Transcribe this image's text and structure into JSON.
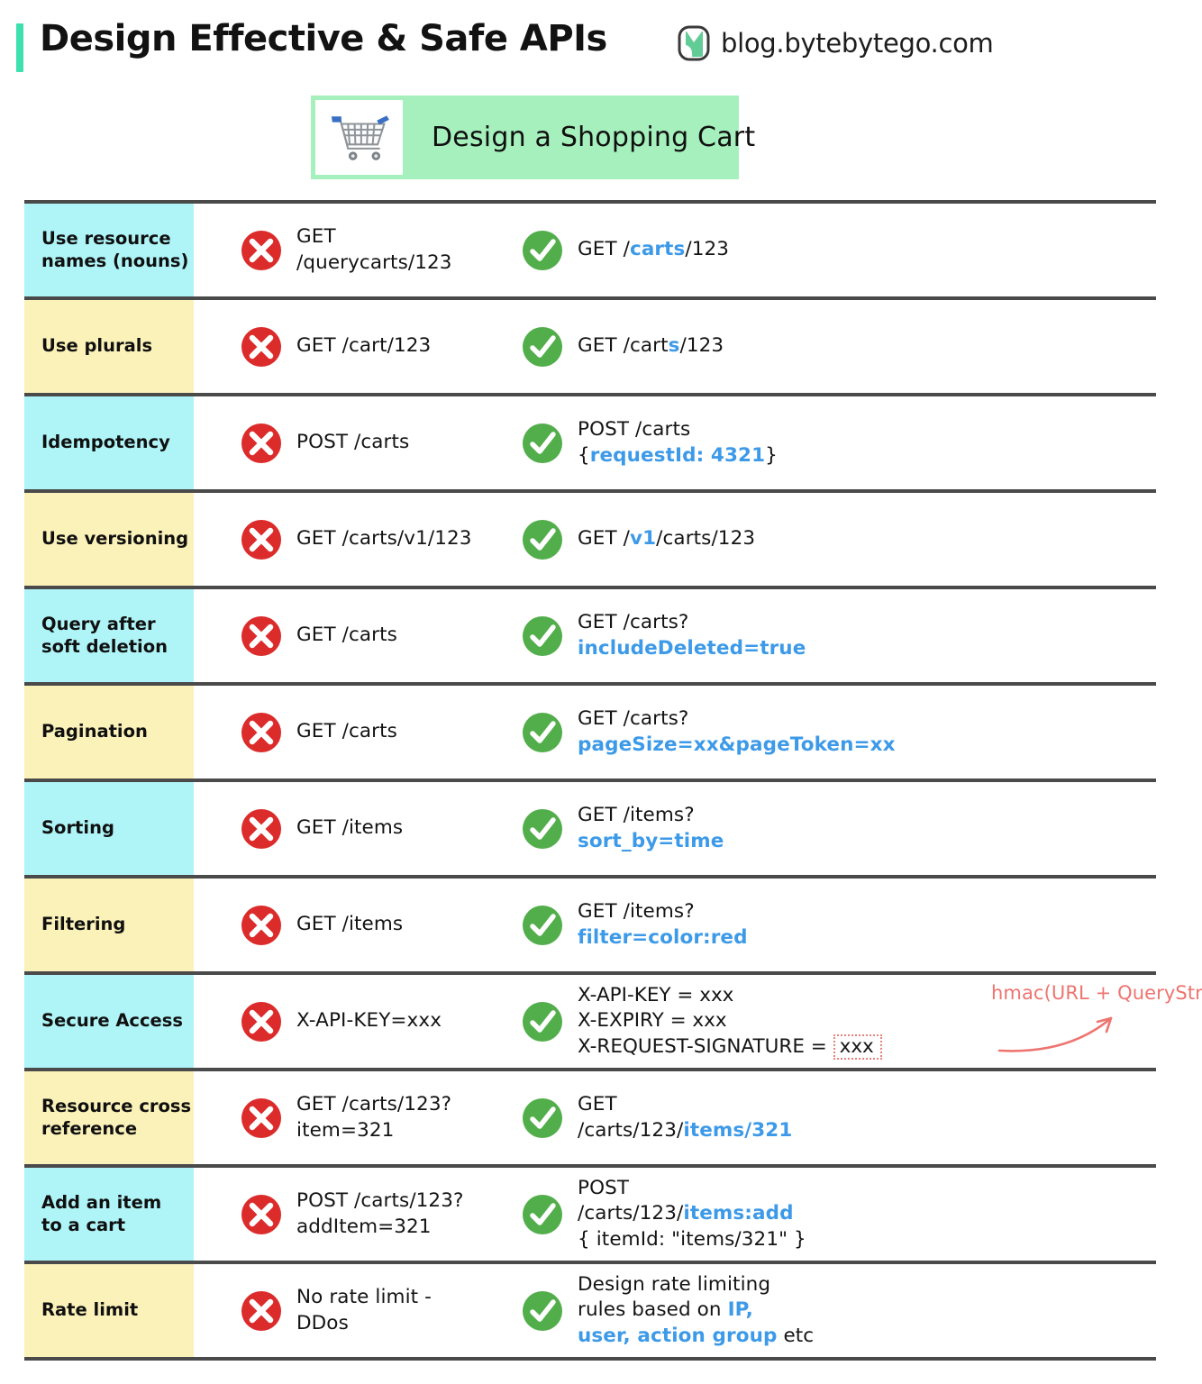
{
  "header": {
    "title": "Design Effective & Safe APIs",
    "brand": "blog.bytebytego.com",
    "logo_icon": "bytebytego-logo-icon",
    "accent_color": "#3ee0ae"
  },
  "banner": {
    "label": "Design a Shopping Cart",
    "icon": "shopping-cart-icon",
    "background_color": "#a5f0bc"
  },
  "legend": {
    "bad_icon": "red-x-circle-icon",
    "good_icon": "green-check-circle-icon",
    "highlight_color": "#3d9ae8",
    "annotation_color": "#ee7470",
    "label_cyan": "#aff5f8",
    "label_yellow": "#fbf2b9"
  },
  "rows": [
    {
      "label": "Use resource\nnames (nouns)",
      "label_color": "cyan",
      "bad": "GET /querycarts/123",
      "good_pre": "GET /",
      "good_hl": "carts",
      "good_post": "/123"
    },
    {
      "label": "Use plurals",
      "label_color": "yellow",
      "bad": "GET /cart/123",
      "good_pre": "GET /cart",
      "good_hl": "s",
      "good_post": "/123"
    },
    {
      "label": "Idempotency",
      "label_color": "cyan",
      "bad": "POST /carts",
      "good_pre": "POST /carts\n{",
      "good_hl": "requestId: 4321",
      "good_post": "}"
    },
    {
      "label": "Use versioning",
      "label_color": "yellow",
      "bad": "GET /carts/v1/123",
      "good_pre": "GET /",
      "good_hl": "v1",
      "good_post": "/carts/123"
    },
    {
      "label": "Query after\nsoft deletion",
      "label_color": "cyan",
      "bad": "GET /carts",
      "good_pre": "GET /carts?\n",
      "good_hl": "includeDeleted=true",
      "good_post": ""
    },
    {
      "label": "Pagination",
      "label_color": "yellow",
      "bad": "GET /carts",
      "good_pre": "GET /carts?\n",
      "good_hl": "pageSize=xx&pageToken=xx",
      "good_post": ""
    },
    {
      "label": "Sorting",
      "label_color": "cyan",
      "bad": "GET /items",
      "good_pre": "GET /items?\n",
      "good_hl": "sort_by=time",
      "good_post": ""
    },
    {
      "label": "Filtering",
      "label_color": "yellow",
      "bad": "GET /items",
      "good_pre": "GET /items?\n",
      "good_hl": "filter=color:red",
      "good_post": ""
    },
    {
      "label": "Secure Access",
      "label_color": "cyan",
      "bad": "X-API-KEY=xxx",
      "secure": {
        "line1": "X-API-KEY = xxx",
        "line2": "X-EXPIRY = xxx",
        "line3_prefix": "X-REQUEST-SIGNATURE = ",
        "line3_boxed": "xxx",
        "annotation": "hmac(URL + QueryString + Expiry + Body)"
      }
    },
    {
      "label": "Resource cross\nreference",
      "label_color": "yellow",
      "bad": "GET /carts/123?\nitem=321",
      "good_pre": "GET\n/carts/123/",
      "good_hl": "items/321",
      "good_post": ""
    },
    {
      "label": "Add an item\nto a cart",
      "label_color": "cyan",
      "bad": "POST /carts/123?\naddItem=321",
      "good_pre": "POST\n/carts/123/",
      "good_hl": "items:add",
      "good_post": "\n{ itemId: \"items/321\" }"
    },
    {
      "label": "Rate limit",
      "label_color": "yellow",
      "bad": "No rate limit -\nDDos",
      "good_pre": "Design rate limiting\nrules based on ",
      "good_hl": "IP,\nuser, action group",
      "good_post": " etc"
    }
  ]
}
